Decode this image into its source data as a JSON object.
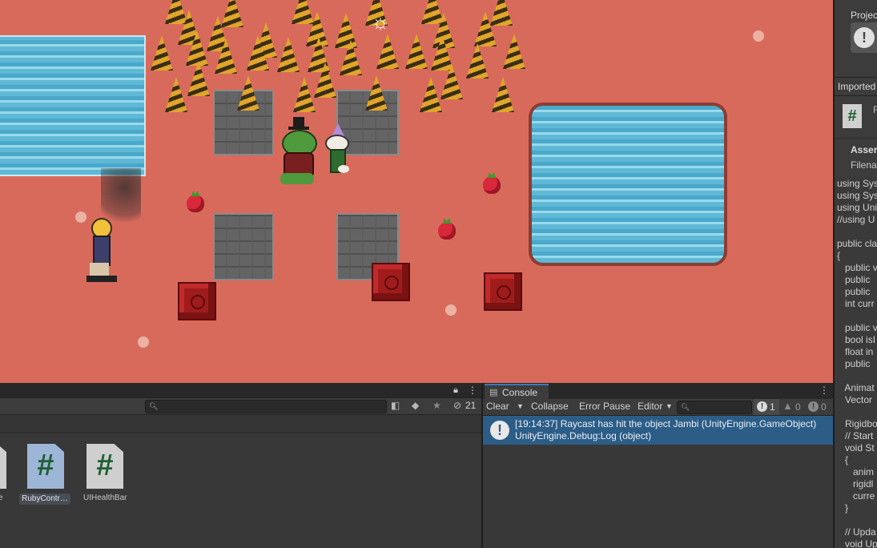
{
  "project_panel": {
    "search_placeholder": "",
    "hidden_count": "21",
    "files": [
      {
        "label": "e",
        "selected": false
      },
      {
        "label": "RubyContr…",
        "selected": true
      },
      {
        "label": "UIHealthBar",
        "selected": false
      }
    ]
  },
  "console": {
    "tab_label": "Console",
    "clear": "Clear",
    "collapse": "Collapse",
    "error_pause": "Error Pause",
    "editor": "Editor",
    "count_info": "1",
    "count_warn": "0",
    "count_error": "0",
    "entries": [
      {
        "line1": "[19:14:37] Raycast has hit the object Jambi (UnityEngine.GameObject)",
        "line2": "UnityEngine.Debug:Log (object)"
      }
    ]
  },
  "inspector": {
    "project_label": "Projec",
    "imported_label": "Imported",
    "asset_letter": "R",
    "assets_label": "Asser",
    "filename_label": "Filena",
    "code_lines": [
      "using Sys",
      "using Sys",
      "using Uni",
      "//using U",
      "",
      "public cla",
      "{",
      "   public v",
      "   public",
      "   public",
      "   int curr",
      "",
      "   public v",
      "   bool isI",
      "   float in",
      "   public",
      "",
      "   Animat",
      "   Vector",
      "",
      "   Rigidbo",
      "   // Start",
      "   void St",
      "   {",
      "      anim",
      "      rigidl",
      "      curre",
      "   }",
      "",
      "   // Upda",
      "   void Up"
    ]
  },
  "colors": {
    "scene_ground": "#d86a5c",
    "selection": "#2c5d87"
  }
}
